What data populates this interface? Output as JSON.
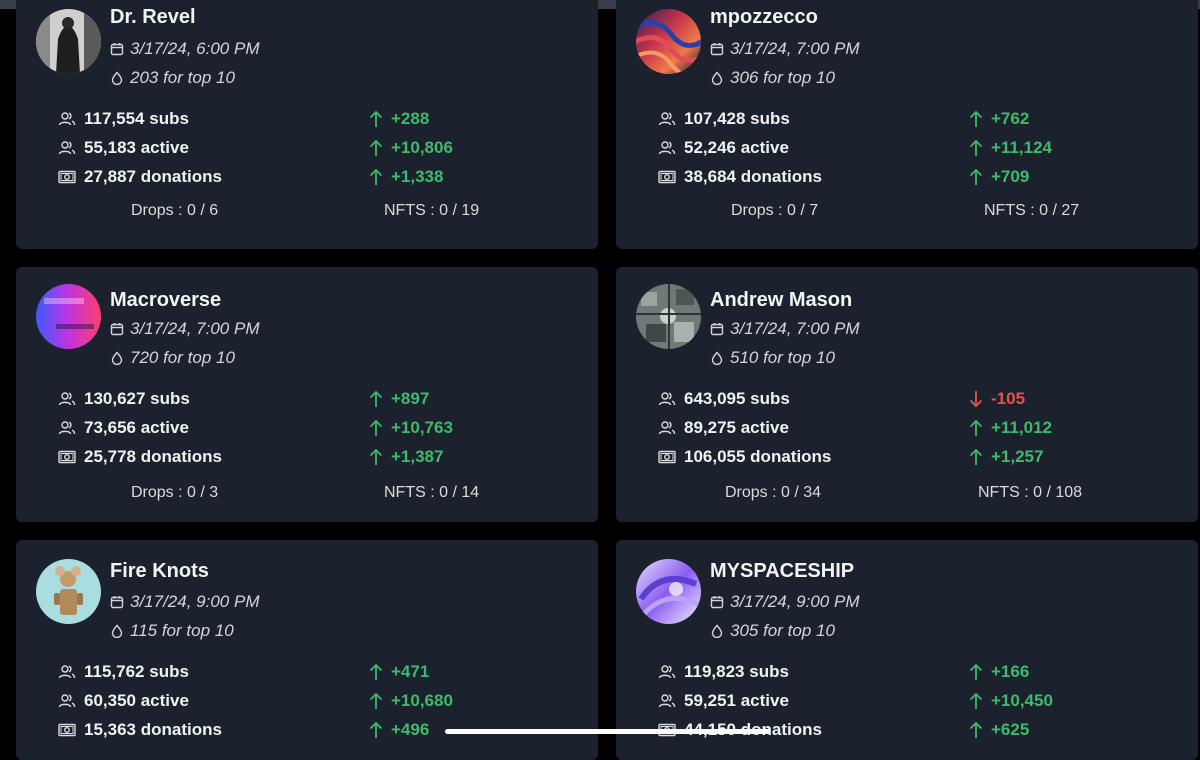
{
  "cards": [
    {
      "name": "Dr. Revel",
      "datetime": "3/17/24, 6:00 PM",
      "top10": "203 for top 10",
      "subs": "117,554 subs",
      "subs_delta": "+288",
      "active": "55,183 active",
      "active_delta": "+10,806",
      "donations": "27,887 donations",
      "donations_delta": "+1,338",
      "drops": "Drops : 0 / 6",
      "nfts": "NFTS : 0 / 19"
    },
    {
      "name": "mpozzecco",
      "datetime": "3/17/24, 7:00 PM",
      "top10": "306 for top 10",
      "subs": "107,428 subs",
      "subs_delta": "+762",
      "active": "52,246 active",
      "active_delta": "+11,124",
      "donations": "38,684 donations",
      "donations_delta": "+709",
      "drops": "Drops : 0 / 7",
      "nfts": "NFTS : 0 / 27"
    },
    {
      "name": "Macroverse",
      "datetime": "3/17/24, 7:00 PM",
      "top10": "720 for top 10",
      "subs": "130,627 subs",
      "subs_delta": "+897",
      "active": "73,656 active",
      "active_delta": "+10,763",
      "donations": "25,778 donations",
      "donations_delta": "+1,387",
      "drops": "Drops : 0 / 3",
      "nfts": "NFTS : 0 / 14"
    },
    {
      "name": "Andrew Mason",
      "datetime": "3/17/24, 7:00 PM",
      "top10": "510 for top 10",
      "subs": "643,095 subs",
      "subs_delta": "-105",
      "active": "89,275 active",
      "active_delta": "+11,012",
      "donations": "106,055 donations",
      "donations_delta": "+1,257",
      "drops": "Drops : 0 / 34",
      "nfts": "NFTS : 0 / 108"
    },
    {
      "name": "Fire Knots",
      "datetime": "3/17/24, 9:00 PM",
      "top10": "115 for top 10",
      "subs": "115,762 subs",
      "subs_delta": "+471",
      "active": "60,350 active",
      "active_delta": "+10,680",
      "donations": "15,363 donations",
      "donations_delta": "+496"
    },
    {
      "name": "MYSPACESHIP",
      "datetime": "3/17/24, 9:00 PM",
      "top10": "305 for top 10",
      "subs": "119,823 subs",
      "subs_delta": "+166",
      "active": "59,251 active",
      "active_delta": "+10,450",
      "donations": "44,150 donations",
      "donations_delta": "+625"
    }
  ],
  "colors": {
    "card_bg": "#1c222d",
    "up": "#3fb96b",
    "down": "#e5534b"
  },
  "icons": {
    "date": "calendar-icon",
    "top10": "drop-icon",
    "users": "users-icon",
    "donations": "banknote-icon",
    "up": "arrow-up-icon",
    "down": "arrow-down-icon"
  }
}
